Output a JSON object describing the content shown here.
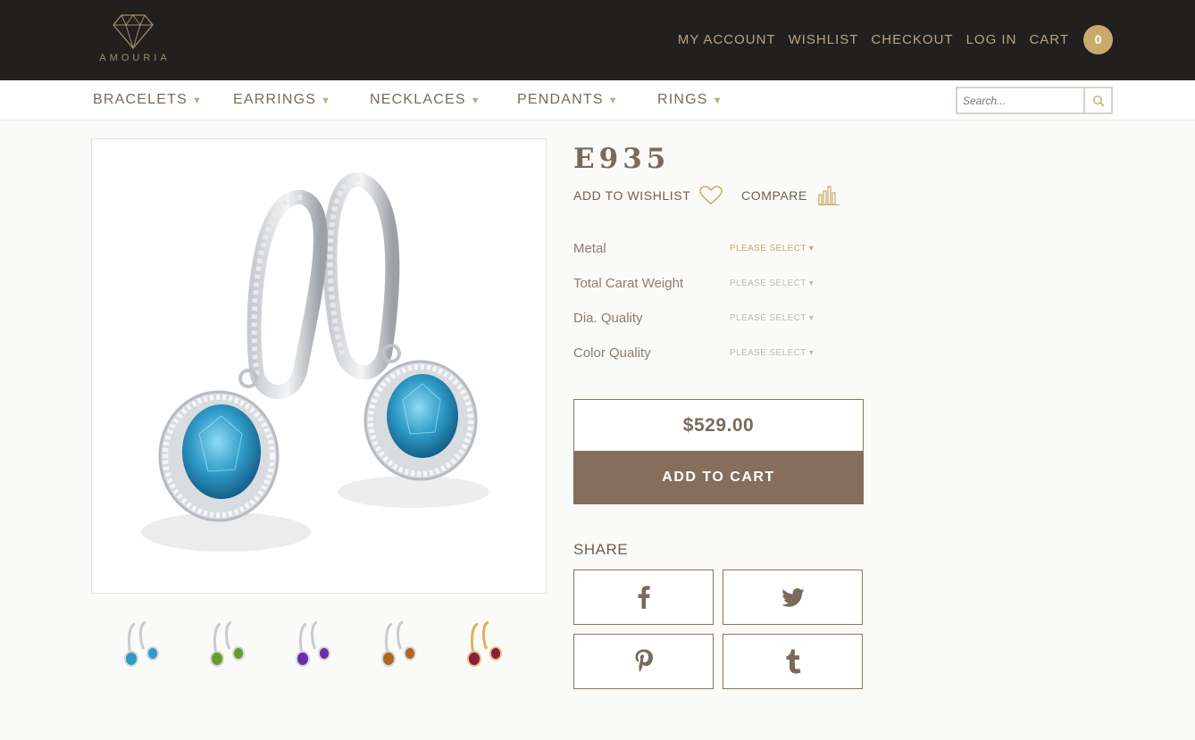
{
  "brand": {
    "name": "AMOURIA"
  },
  "topnav": {
    "items": [
      {
        "label": "MY ACCOUNT"
      },
      {
        "label": "WISHLIST"
      },
      {
        "label": "CHECKOUT"
      },
      {
        "label": "LOG IN"
      },
      {
        "label": "CART"
      }
    ],
    "cart_count": "0"
  },
  "categories": [
    {
      "label": "BRACELETS"
    },
    {
      "label": "EARRINGS"
    },
    {
      "label": "NECKLACES"
    },
    {
      "label": "PENDANTS"
    },
    {
      "label": "RINGS"
    }
  ],
  "dropdown_arrow": "▼",
  "search": {
    "placeholder": "Search..."
  },
  "product": {
    "title": "E935",
    "add_to_wishlist": "ADD TO WISHLIST",
    "compare": "COMPARE",
    "options": [
      {
        "label": "Metal",
        "value": "PLEASE SELECT ▾"
      },
      {
        "label": "Total Carat Weight",
        "value": "PLEASE SELECT ▾"
      },
      {
        "label": "Dia. Quality",
        "value": "PLEASE SELECT ▾"
      },
      {
        "label": "Color Quality",
        "value": "PLEASE SELECT ▾"
      }
    ],
    "price": "$529.00",
    "add_to_cart": "ADD TO CART",
    "share_label": "SHARE",
    "thumbnail_colors": [
      "#2f9bc7",
      "#6a9a2c",
      "#6a2fa8",
      "#b0661e",
      "#8a1e3a"
    ]
  },
  "colors": {
    "header_bg": "#231f1e",
    "accent_gold": "#c9aa6c",
    "brown": "#856e5c",
    "gem_blue": "#2f9bc7"
  }
}
